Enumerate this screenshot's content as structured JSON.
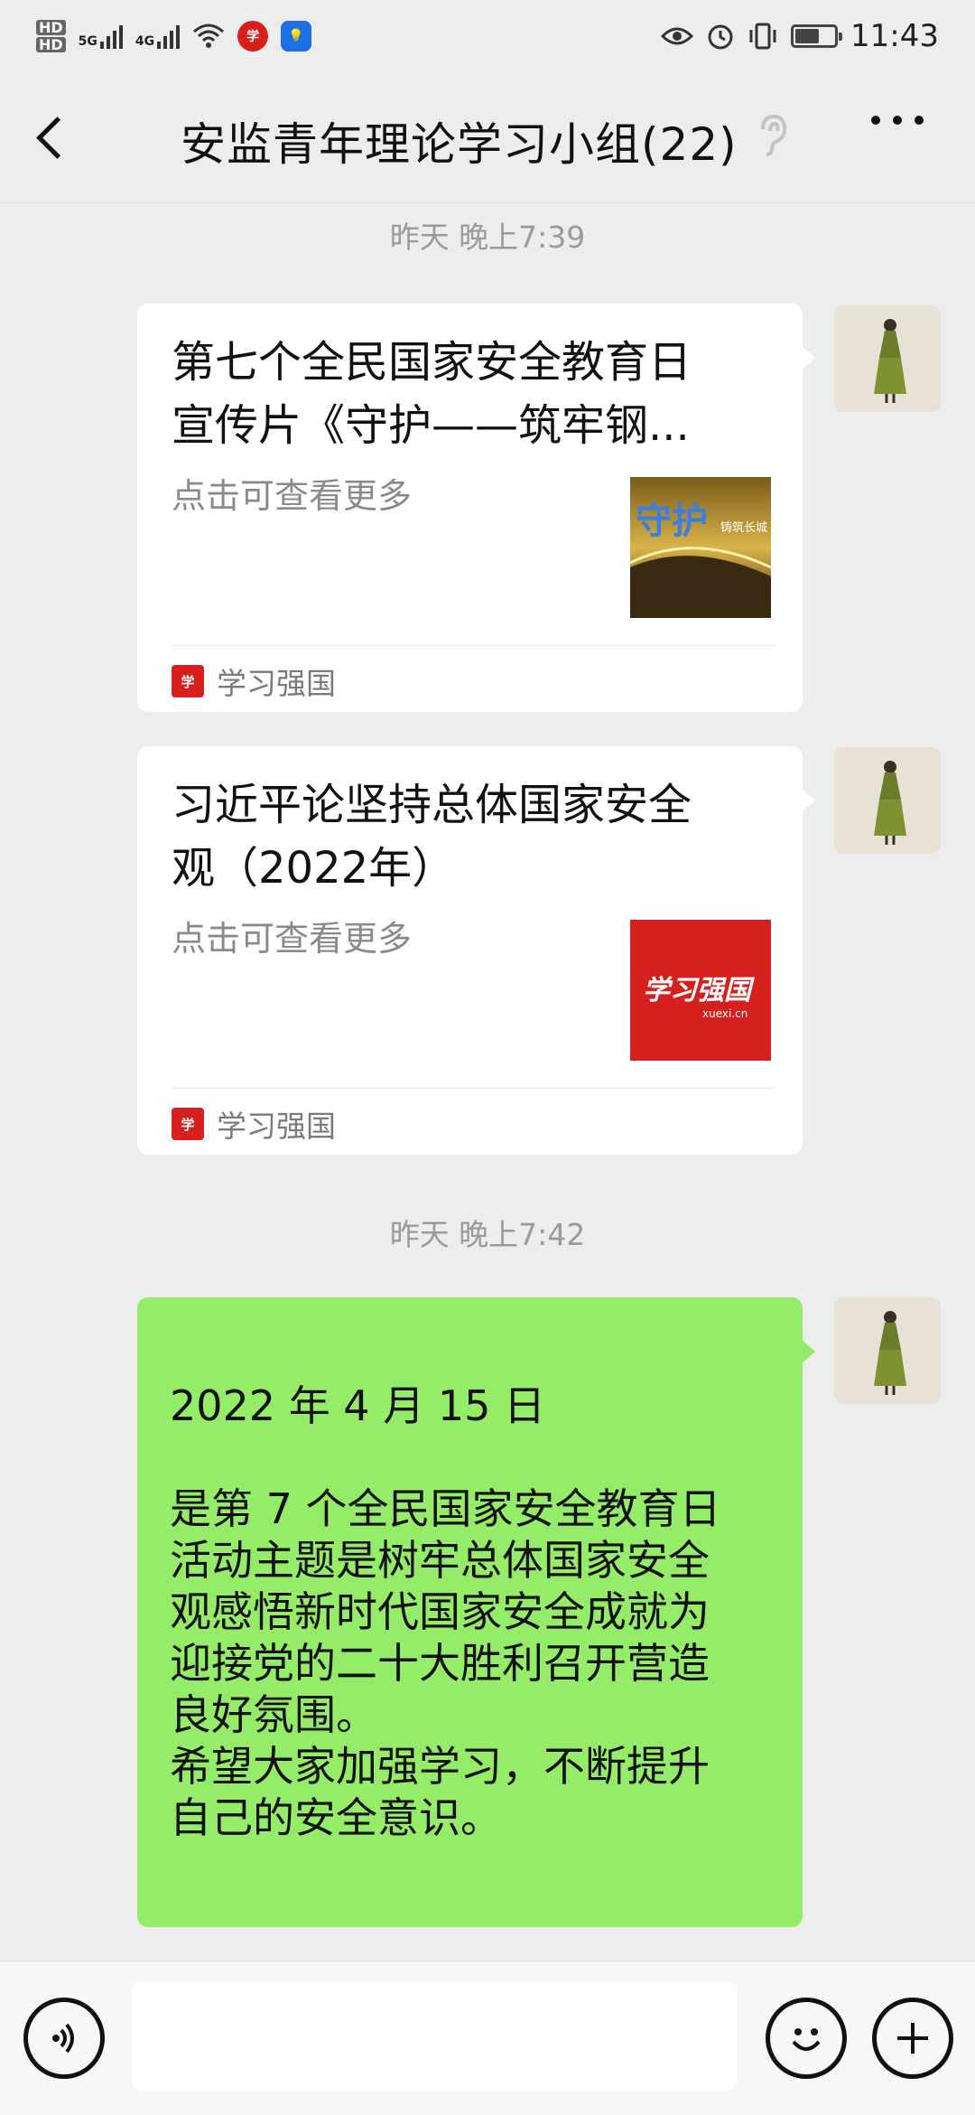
{
  "status": {
    "time": "11:43",
    "hd1": "HD",
    "hd2": "HD",
    "net1": "5G",
    "net2": "4G",
    "battery_level": 0.62
  },
  "nav": {
    "title": "安监青年理论学习小组(22)"
  },
  "messages": [
    {
      "time": "昨天 晚上7:39",
      "card_title": "第七个全民国家安全教育日宣传片《守护——筑牢钢...",
      "card_desc": "点击可查看更多",
      "source": "学习强国"
    },
    {
      "card_title": "习近平论坚持总体国家安全观（2022年）",
      "card_desc": "点击可查看更多",
      "source": "学习强国"
    }
  ],
  "time2": "昨天 晚上7:42",
  "text_message": "2022 年 4 月 15 日\n\n是第 7 个全民国家安全教育日\n活动主题是树牢总体国家安全\n观感悟新时代国家安全成就为\n迎接党的二十大胜利召开营造\n良好氛围。\n希望大家加强学习，不断提升\n自己的安全意识。",
  "thumb1": {
    "text": "守护",
    "sub": "铸筑长城"
  },
  "thumb2": {
    "text": "学习强国",
    "sub": "xuexi.cn"
  },
  "colors": {
    "background": "#ededed",
    "bubble": "#95ec69",
    "brand_red": "#d6201e"
  }
}
